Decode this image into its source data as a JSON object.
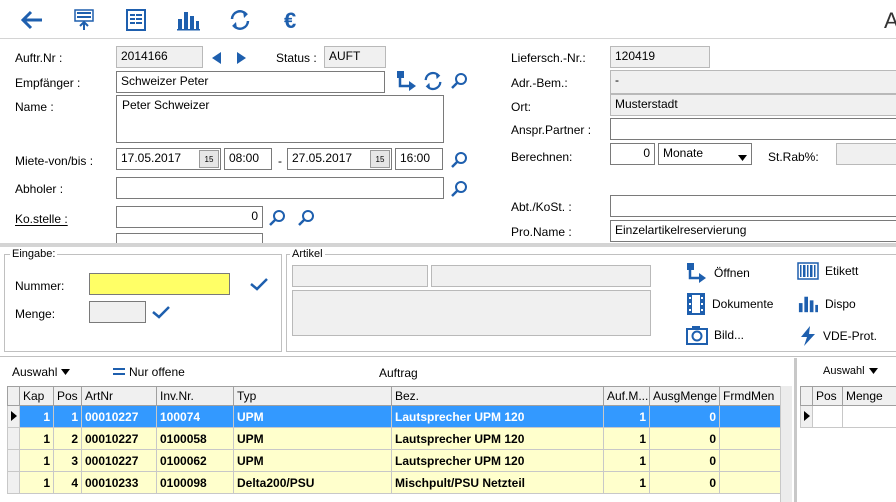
{
  "toolbar": {
    "icons": [
      "back-arrow-icon",
      "upload-form-icon",
      "document-list-icon",
      "bar-chart-icon",
      "refresh-icon",
      "euro-icon"
    ],
    "title_fragment": "A"
  },
  "header": {
    "auftr_nr_label": "Auftr.Nr :",
    "auftr_nr": "2014166",
    "status_label": "Status :",
    "status": "AUFT",
    "empfaenger_label": "Empfänger :",
    "empfaenger": "Schweizer Peter",
    "name_label": "Name :",
    "name": "Peter Schweizer",
    "miete_label": "Miete-von/bis :",
    "miete_von_datum": "17.05.2017",
    "miete_von_zeit": "08:00",
    "dash": "-",
    "miete_bis_datum": "27.05.2017",
    "miete_bis_zeit": "16:00",
    "abholer_label": "Abholer :",
    "abholer": "",
    "kostelle_label": "Ko.stelle :",
    "kostelle": "0",
    "lieferschein_label": "Liefersch.-Nr.:",
    "lieferschein": "120419",
    "adr_bem_label": "Adr.-Bem.:",
    "adr_bem": "-",
    "ort_label": "Ort:",
    "ort": "Musterstadt",
    "anspr_label": "Anspr.Partner :",
    "anspr": "",
    "berechnen_label": "Berechnen:",
    "berechnen_wert": "0",
    "berechnen_einheit": "Monate",
    "strab_label": "St.Rab%:",
    "abt_label": "Abt./KoSt. :",
    "abt": "",
    "proname_label": "Pro.Name :",
    "proname": "Einzelartikelreservierung",
    "cal_glyph": "15"
  },
  "eingabe": {
    "title": "Eingabe:",
    "nummer_label": "Nummer:",
    "nummer": "",
    "menge_label": "Menge:",
    "menge": ""
  },
  "artikel": {
    "title": "Artikel"
  },
  "actions": {
    "oeffnen": "Öffnen",
    "dokumente": "Dokumente",
    "bild": "Bild...",
    "etikett": "Etikett",
    "dispo": "Dispo",
    "vde": "VDE-Prot."
  },
  "grid_bar": {
    "auswahl": "Auswahl",
    "nur_offene": "Nur offene",
    "auftrag": "Auftrag",
    "auswahl_right": "Auswahl"
  },
  "table": {
    "columns": [
      "Kap",
      "Pos",
      "ArtNr",
      "Inv.Nr.",
      "Typ",
      "Bez.",
      "Auf.M...",
      "AusgMenge",
      "FrmdMen"
    ],
    "rows": [
      {
        "kap": "1",
        "pos": "1",
        "artnr": "00010227",
        "invnr": "100074",
        "typ": "UPM",
        "bez": "Lautsprecher UPM 120",
        "aufm": "1",
        "ausg": "0",
        "frmd": ""
      },
      {
        "kap": "1",
        "pos": "2",
        "artnr": "00010227",
        "invnr": "0100058",
        "typ": "UPM",
        "bez": "Lautsprecher UPM 120",
        "aufm": "1",
        "ausg": "0",
        "frmd": ""
      },
      {
        "kap": "1",
        "pos": "3",
        "artnr": "00010227",
        "invnr": "0100062",
        "typ": "UPM",
        "bez": "Lautsprecher UPM 120",
        "aufm": "1",
        "ausg": "0",
        "frmd": ""
      },
      {
        "kap": "1",
        "pos": "4",
        "artnr": "00010233",
        "invnr": "0100098",
        "typ": "Delta200/PSU",
        "bez": "Mischpult/PSU Netzteil",
        "aufm": "1",
        "ausg": "0",
        "frmd": ""
      }
    ]
  },
  "right_table": {
    "columns": [
      "Pos",
      "Menge"
    ]
  }
}
